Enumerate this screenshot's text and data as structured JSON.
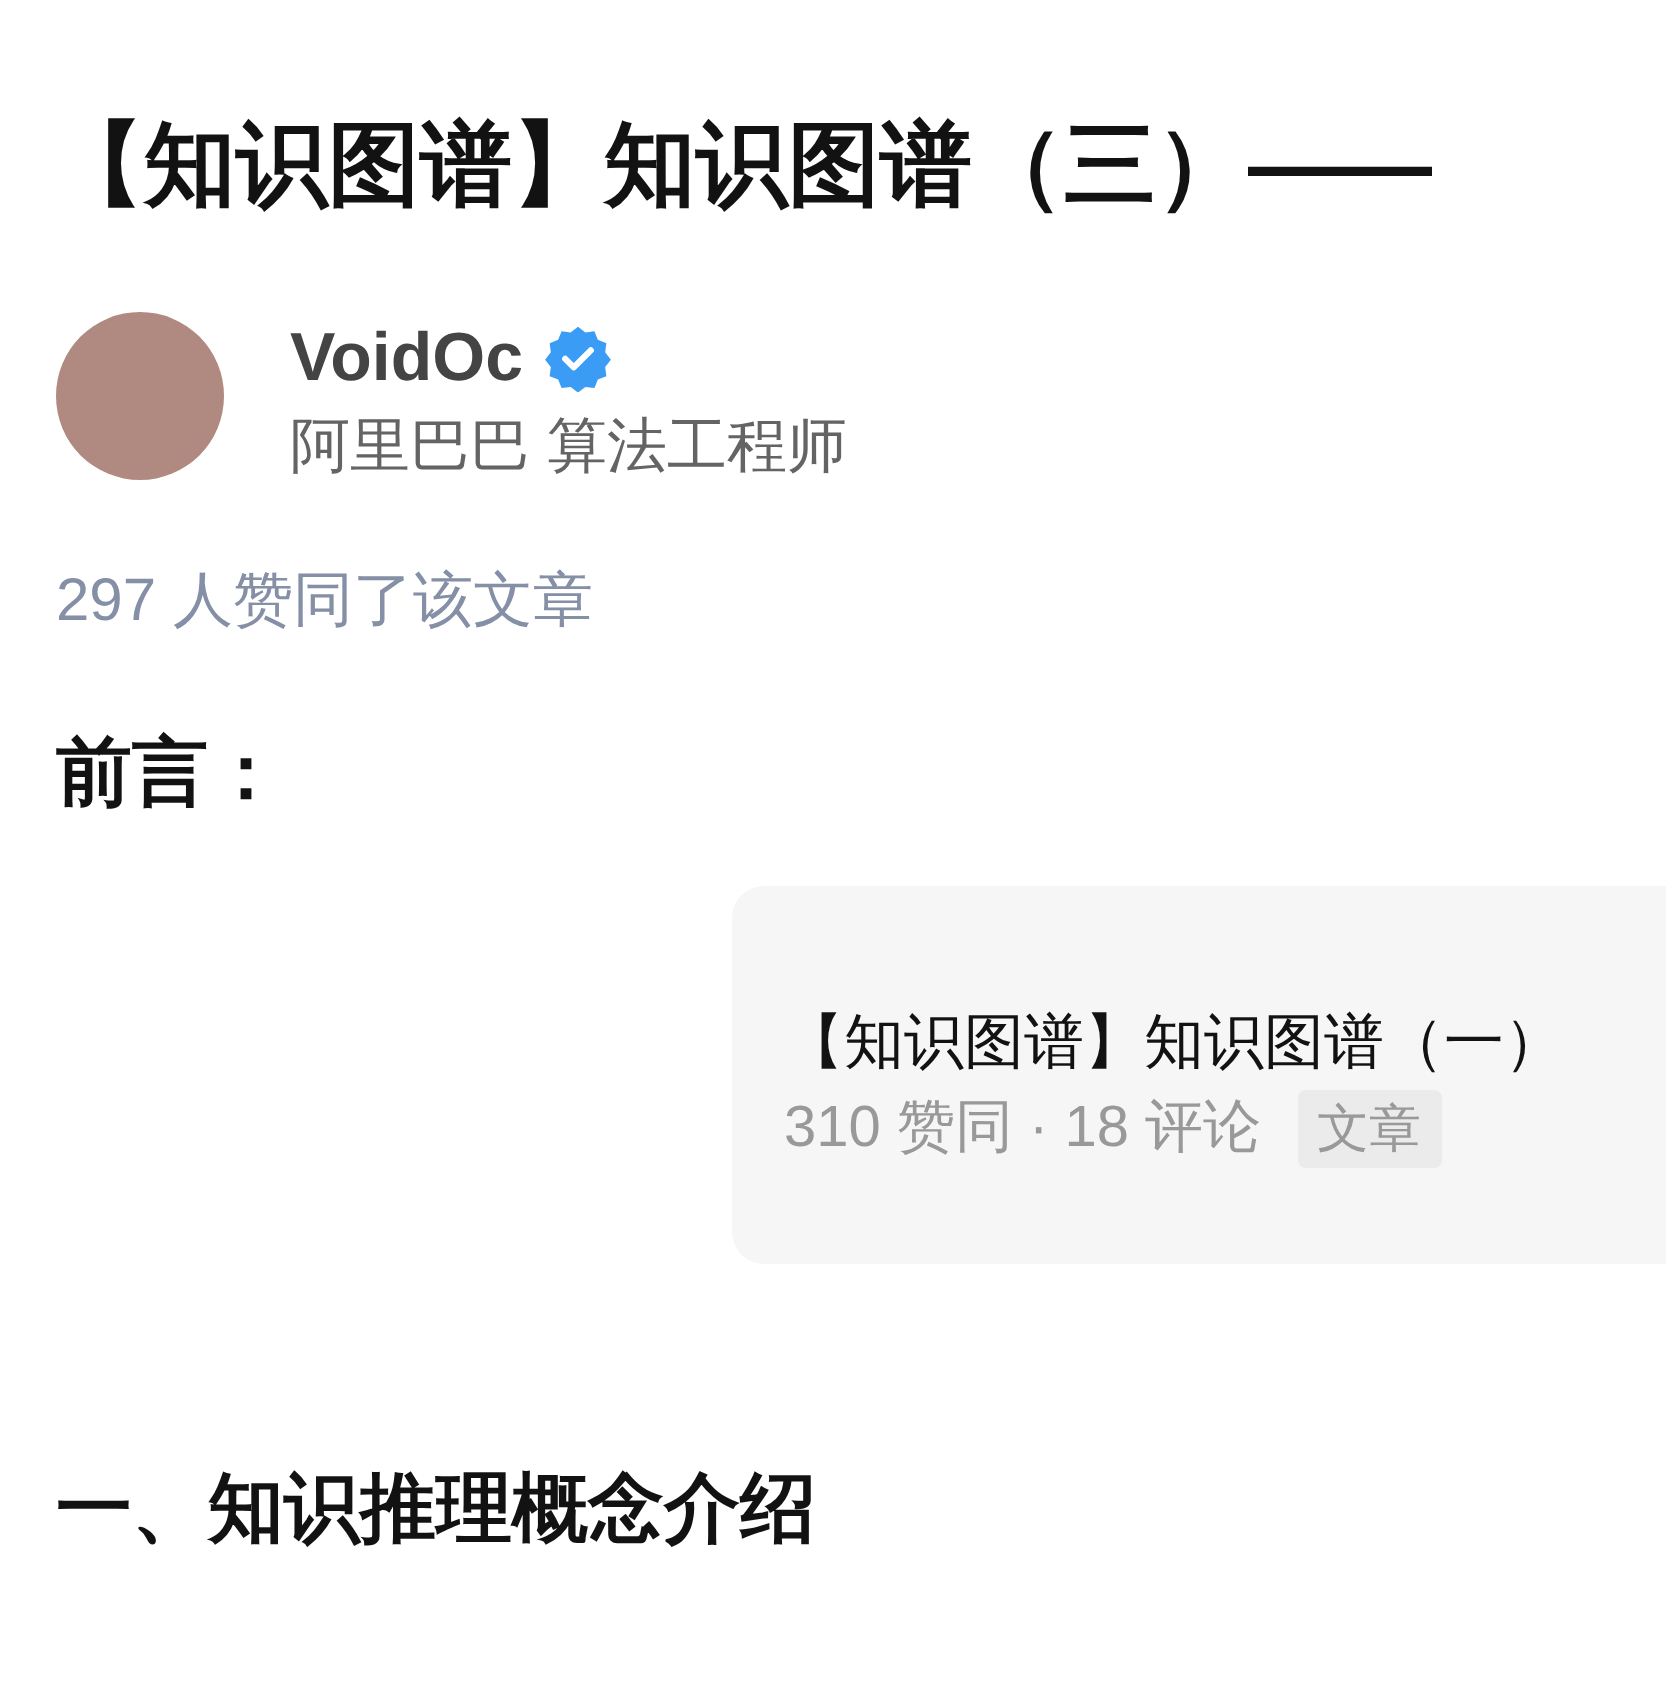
{
  "title": "【知识图谱】知识图谱（三）——",
  "author": {
    "name": "VoidOc",
    "verified": true,
    "headline": "阿里巴巴 算法工程师"
  },
  "upvote_summary": "297 人赞同了该文章",
  "sections": [
    {
      "kind": "heading",
      "text": "前言："
    },
    {
      "kind": "link_card",
      "title": "【知识图谱】知识图谱（一）",
      "meta": "310 赞同 · 18 评论",
      "tag": "文章"
    },
    {
      "kind": "heading",
      "text": "一、知识推理概念介绍"
    }
  ]
}
